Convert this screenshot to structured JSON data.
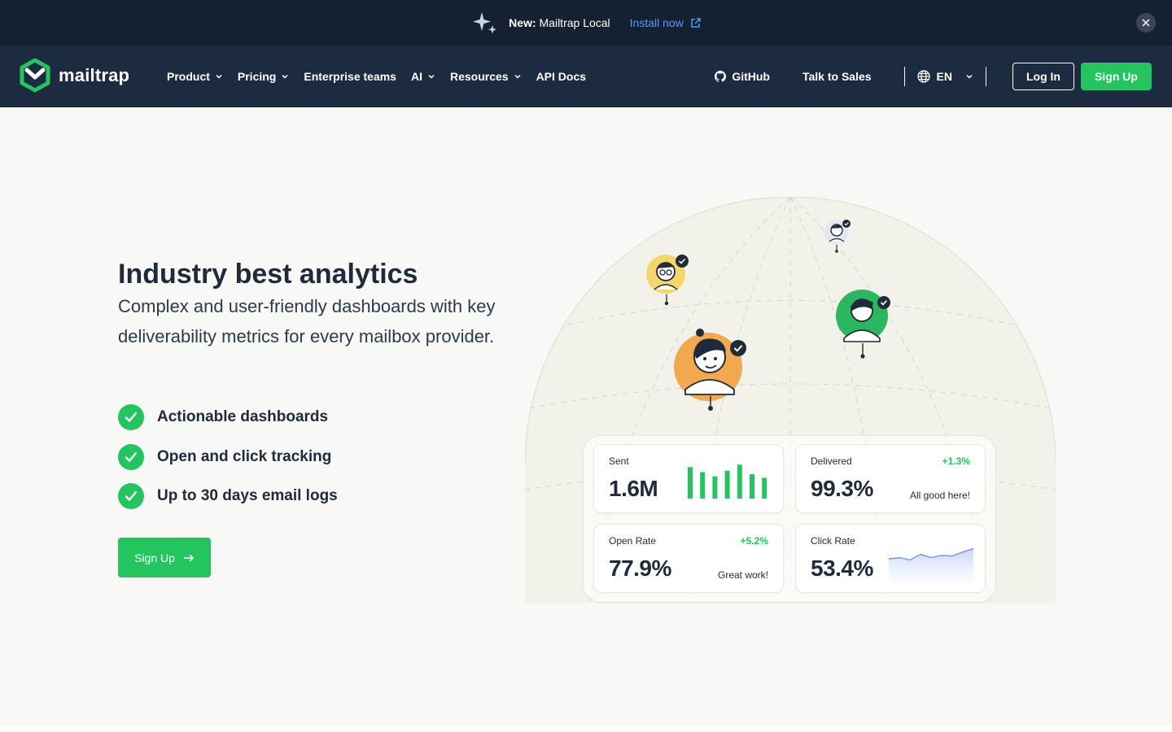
{
  "announce": {
    "new_label": "New:",
    "product": "Mailtrap Local",
    "install": "Install now"
  },
  "nav": {
    "brand": "mailtrap",
    "menu": [
      {
        "label": "Product",
        "dropdown": true
      },
      {
        "label": "Pricing",
        "dropdown": true
      },
      {
        "label": "Enterprise teams",
        "dropdown": false
      },
      {
        "label": "AI",
        "dropdown": true
      },
      {
        "label": "Resources",
        "dropdown": true
      },
      {
        "label": "API Docs",
        "dropdown": false
      }
    ],
    "github": "GitHub",
    "talk": "Talk to Sales",
    "lang": "EN",
    "login": "Log In",
    "signup": "Sign Up"
  },
  "hero": {
    "title": "Industry best analytics",
    "subtitle": "Complex and user-friendly dashboards with key deliverability metrics for every mailbox provider.",
    "features": [
      "Actionable dashboards",
      "Open and click tracking",
      "Up to 30 days email logs"
    ],
    "cta": "Sign Up"
  },
  "stats": {
    "sent": {
      "label": "Sent",
      "value": "1.6M",
      "bars": [
        0.88,
        0.74,
        0.62,
        0.78,
        0.95,
        0.68,
        0.58
      ]
    },
    "delivered": {
      "label": "Delivered",
      "value": "99.3%",
      "delta": "+1.3%",
      "note": "All good here!"
    },
    "open_rate": {
      "label": "Open Rate",
      "value": "77.9%",
      "delta": "+5.2%",
      "note": "Great work!"
    },
    "click_rate": {
      "label": "Click Rate",
      "value": "53.4%",
      "trend": [
        0.42,
        0.48,
        0.38,
        0.62,
        0.48,
        0.58,
        0.55,
        0.72,
        0.88
      ]
    }
  },
  "colors": {
    "accent": "#22c55e",
    "navy": "#1d2b40",
    "dark": "#152030",
    "link": "#4f9dff"
  }
}
